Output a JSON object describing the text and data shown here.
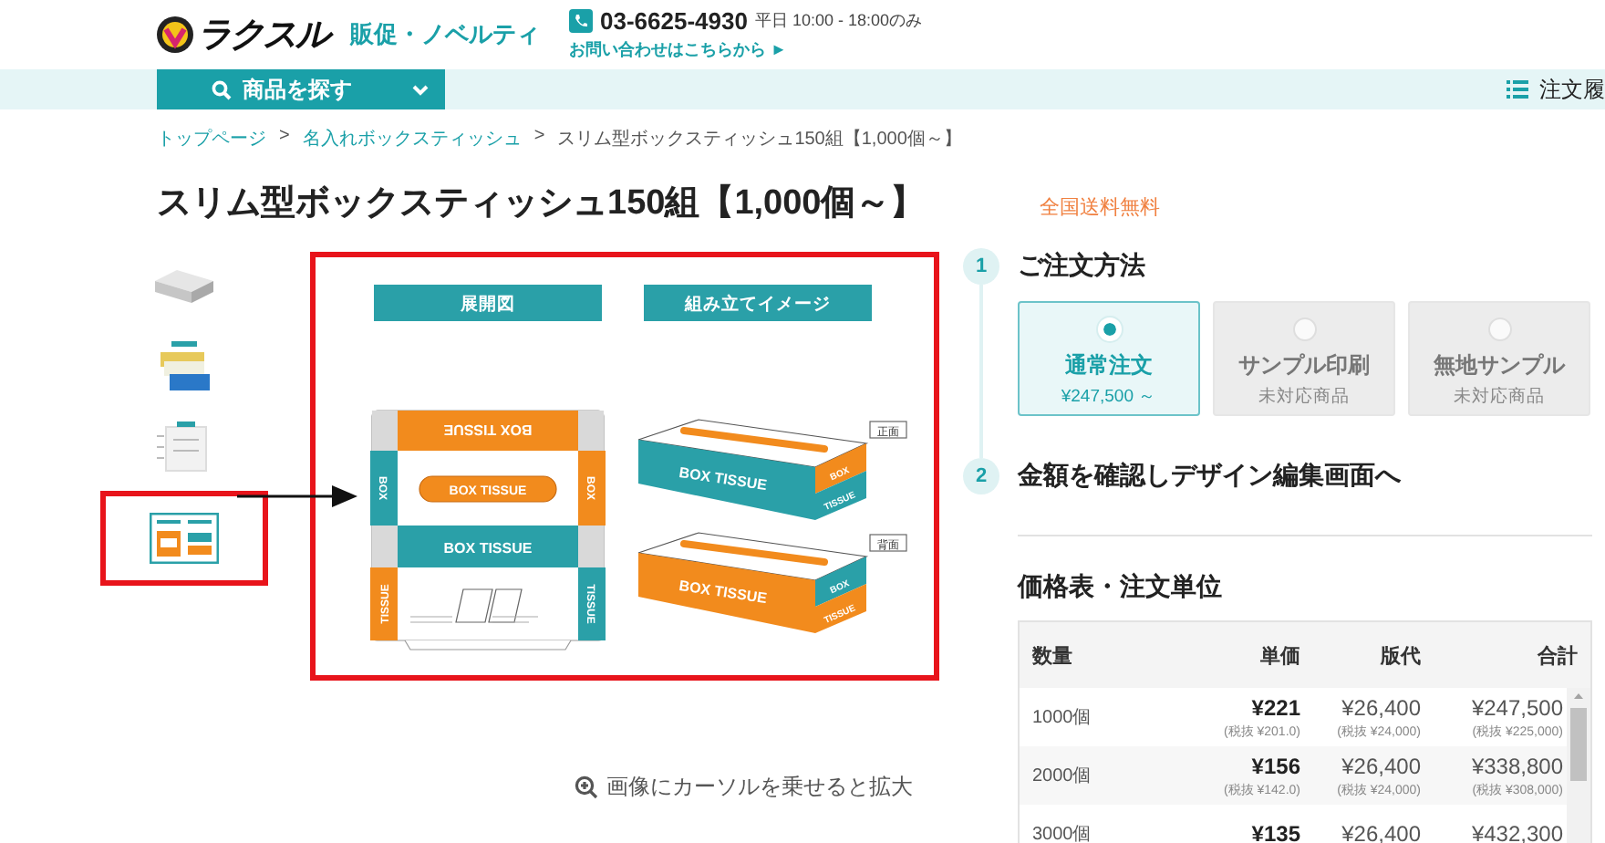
{
  "header": {
    "logo": "ラクスル",
    "tagline": "販促・ノベルティ",
    "phone": "03-6625-4930",
    "hours": "平日 10:00 - 18:00のみ",
    "contact_link": "お問い合わせはこちらから ►"
  },
  "nav": {
    "search_button": "商品を探す",
    "order_history": "注文履"
  },
  "breadcrumb": [
    {
      "label": "トップページ",
      "link": true,
      "separator": ">"
    },
    {
      "label": "名入れボックスティッシュ",
      "link": true,
      "separator": ">"
    },
    {
      "label": "スリム型ボックスティッシュ150組【1,000個～】",
      "link": false
    }
  ],
  "title": "スリム型ボックスティッシュ150組【1,000個～】",
  "shipping_badge": "全国送料無料",
  "thumbnails": [
    {
      "kind": "plain-box",
      "selected": false
    },
    {
      "kind": "box-stack",
      "selected": false
    },
    {
      "kind": "spec-sheet",
      "selected": false
    },
    {
      "kind": "diagram",
      "selected": true
    }
  ],
  "main_image": {
    "panel_headers": [
      "展開図",
      "組み立てイメージ"
    ],
    "net": {
      "top_band": "BOX TISSUE",
      "left_flap": "BOX",
      "right_flap": "BOX",
      "center_label": "BOX TISSUE",
      "middle_band": "BOX TISSUE",
      "bottom_left_flap": "TISSUE",
      "bottom_right_flap": "TISSUE"
    },
    "views": [
      {
        "label": "正面",
        "front_text": "BOX TISSUE",
        "side_texts": [
          "BOX",
          "TISSUE"
        ],
        "color": "#2aa0a8"
      },
      {
        "label": "背面",
        "front_text": "BOX TISSUE",
        "side_texts": [
          "BOX",
          "TISSUE"
        ],
        "color": "#f28b1d"
      }
    ]
  },
  "zoom_hint": "画像にカーソルを乗せると拡大",
  "steps": [
    {
      "number": "1",
      "title": "ご注文方法"
    },
    {
      "number": "2",
      "title": "金額を確認しデザイン編集画面へ"
    }
  ],
  "order_options": [
    {
      "title": "通常注文",
      "note": "¥247,500 ～",
      "selected": true,
      "disabled": false
    },
    {
      "title": "サンプル印刷",
      "note": "未対応商品",
      "selected": false,
      "disabled": true
    },
    {
      "title": "無地サンプル",
      "note": "未対応商品",
      "selected": false,
      "disabled": true
    }
  ],
  "price_table": {
    "title": "価格表・注文単位",
    "columns": [
      "数量",
      "単価",
      "版代",
      "合計"
    ],
    "rows": [
      {
        "quantity": "1000個",
        "unit_price": "¥221",
        "unit_price_ex_tax": "(税抜 ¥201.0)",
        "plate_fee": "¥26,400",
        "plate_fee_ex_tax": "(税抜 ¥24,000)",
        "total": "¥247,500",
        "total_ex_tax": "(税抜 ¥225,000)"
      },
      {
        "quantity": "2000個",
        "unit_price": "¥156",
        "unit_price_ex_tax": "(税抜 ¥142.0)",
        "plate_fee": "¥26,400",
        "plate_fee_ex_tax": "(税抜 ¥24,000)",
        "total": "¥338,800",
        "total_ex_tax": "(税抜 ¥308,000)"
      },
      {
        "quantity": "3000個",
        "unit_price": "¥135",
        "plate_fee": "¥26,400",
        "total": "¥432,300"
      }
    ]
  }
}
